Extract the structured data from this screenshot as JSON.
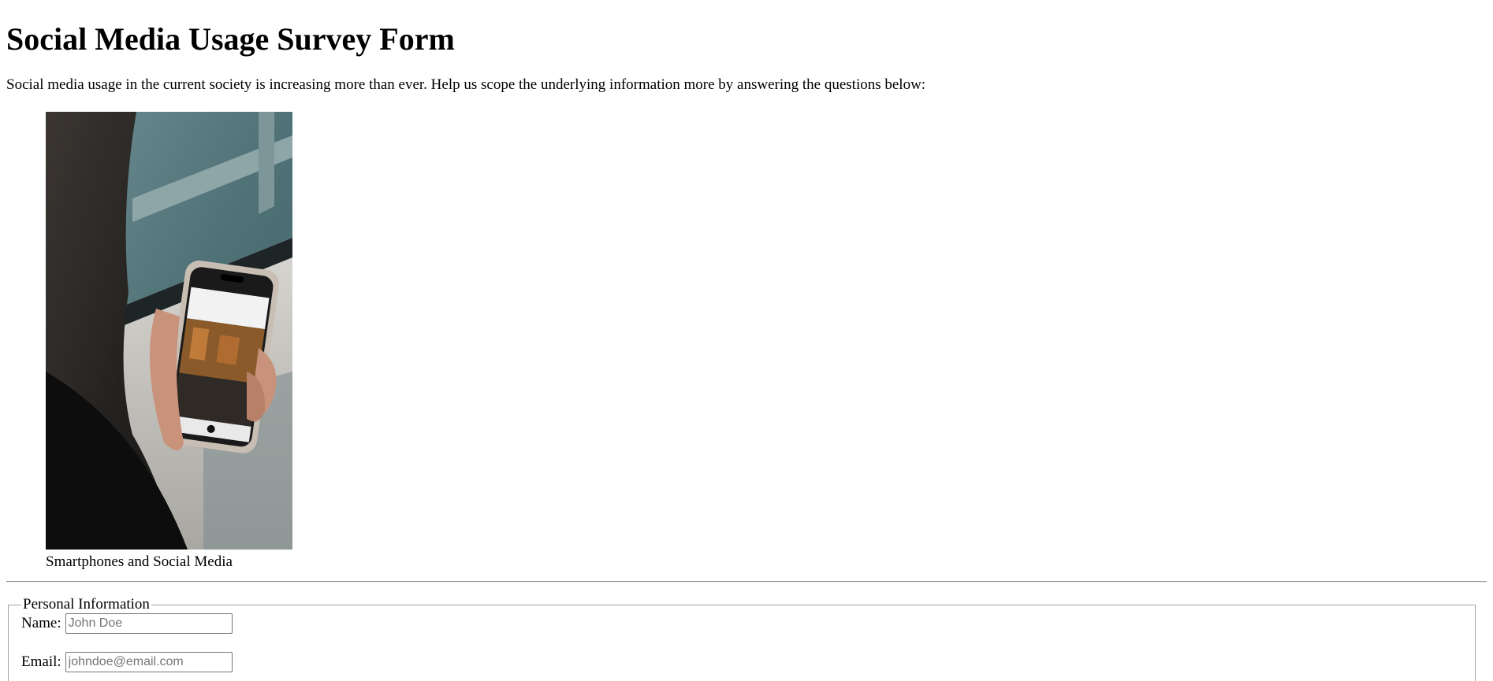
{
  "page": {
    "title": "Social Media Usage Survey Form",
    "intro": "Social media usage in the current society is increasing more than ever. Help us scope the underlying information more by answering the questions below:"
  },
  "figure": {
    "caption": "Smartphones and Social Media",
    "image_subject": "person-holding-smartphone-photo"
  },
  "personal_info": {
    "legend": "Personal Information",
    "fields": [
      {
        "label": "Name:",
        "placeholder": "John Doe",
        "value": ""
      },
      {
        "label": "Email:",
        "placeholder": "johndoe@email.com",
        "value": ""
      }
    ]
  }
}
